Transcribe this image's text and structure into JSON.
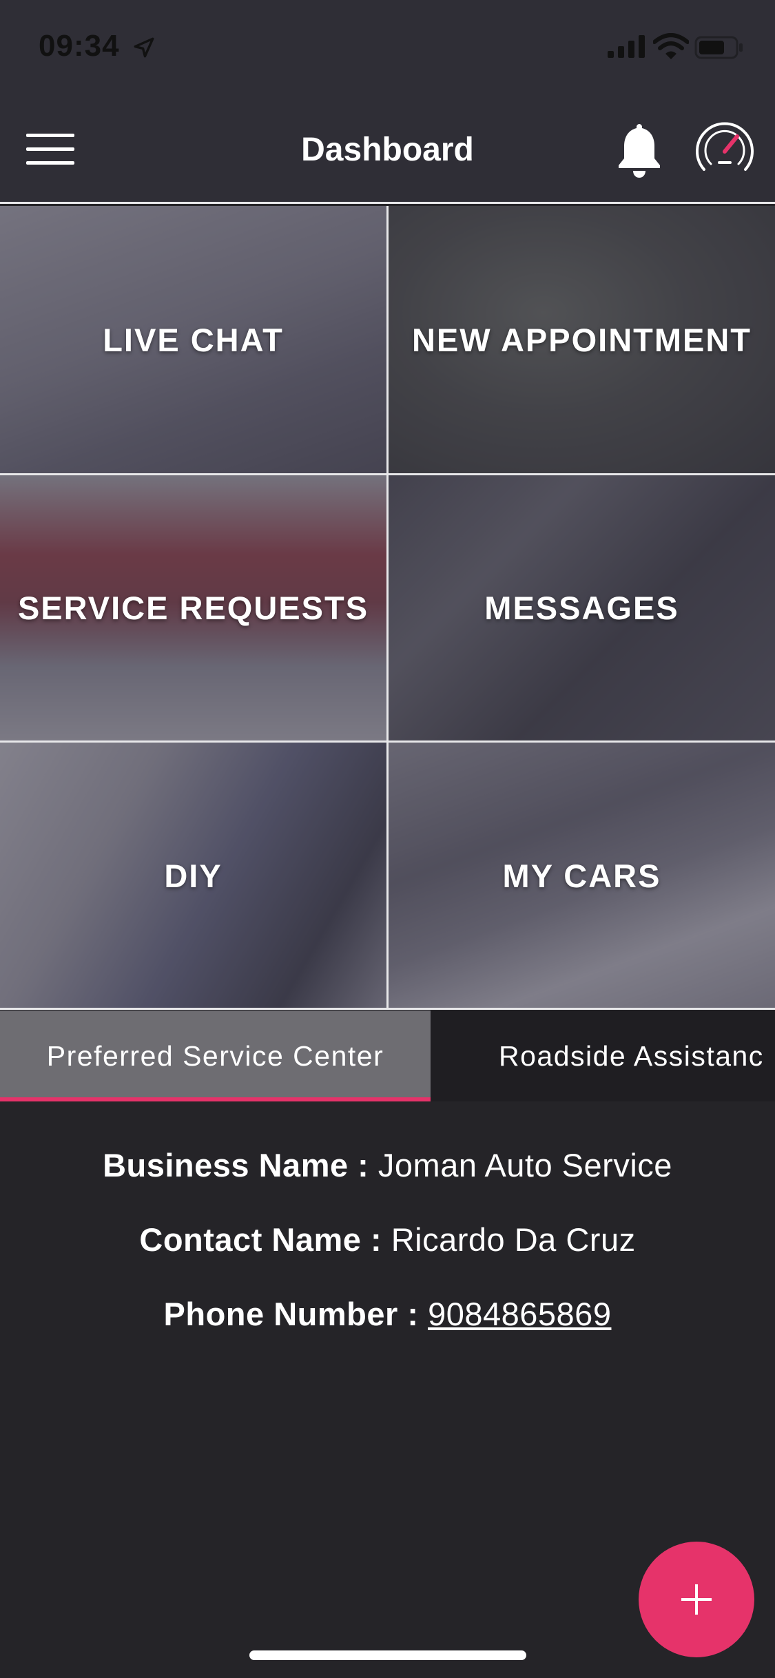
{
  "status_bar": {
    "time": "09:34"
  },
  "nav": {
    "title": "Dashboard"
  },
  "tiles": [
    {
      "label": "LIVE CHAT"
    },
    {
      "label": "NEW APPOINTMENT"
    },
    {
      "label": "SERVICE REQUESTS"
    },
    {
      "label": "MESSAGES"
    },
    {
      "label": "DIY"
    },
    {
      "label": "MY CARS"
    }
  ],
  "tabs": [
    {
      "label": "Preferred Service Center",
      "active": true
    },
    {
      "label": "Roadside Assistanc",
      "active": false
    }
  ],
  "service_center": {
    "business_label": "Business Name :",
    "business_value": "Joman Auto Service",
    "contact_label": "Contact Name :",
    "contact_value": "Ricardo Da Cruz",
    "phone_label": "Phone Number :",
    "phone_value": "9084865869"
  },
  "colors": {
    "accent": "#e6336a",
    "nav_background": "#2f2e36",
    "page_background": "#252428",
    "active_tab": "#6e6d72"
  },
  "icons": [
    "menu-icon",
    "bell-icon",
    "speedometer-icon",
    "location-arrow-icon",
    "cellular-signal-icon",
    "wifi-icon",
    "battery-icon",
    "plus-icon"
  ]
}
